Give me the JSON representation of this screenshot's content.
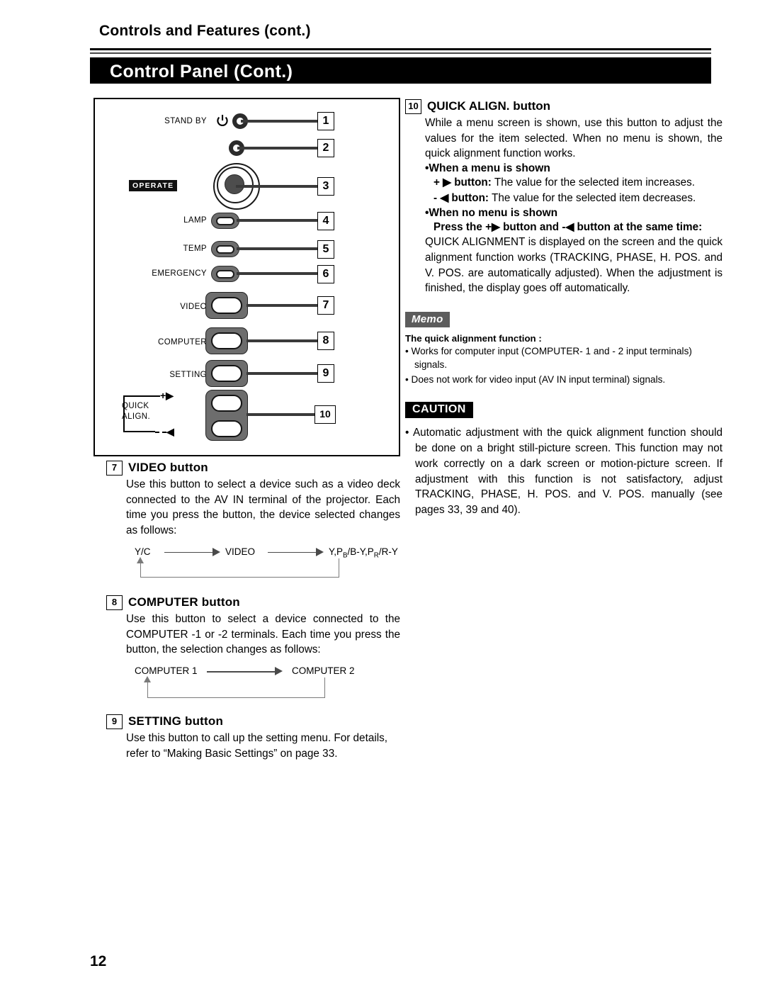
{
  "header": {
    "running_head": "Controls and Features (cont.)",
    "title": "Control Panel (Cont.)"
  },
  "diagram": {
    "name": "control-panel-illustration",
    "labels": [
      {
        "text": "STAND BY",
        "callout": "1"
      },
      {
        "text": "",
        "callout": "2"
      },
      {
        "text": "OPERATE",
        "callout": "3"
      },
      {
        "text": "LAMP",
        "callout": "4"
      },
      {
        "text": "TEMP",
        "callout": "5"
      },
      {
        "text": "EMERGENCY",
        "callout": "6"
      },
      {
        "text": "VIDEO",
        "callout": "7"
      },
      {
        "text": "COMPUTER",
        "callout": "8"
      },
      {
        "text": "SETTING",
        "callout": "9"
      },
      {
        "text": "QUICK ALIGN.",
        "callout": "10"
      }
    ],
    "stand_by_label": "STAND BY",
    "operate_label": "OPERATE",
    "lamp_label": "LAMP",
    "temp_label": "TEMP",
    "emergency_label": "EMERGENCY",
    "video_label": "VIDEO",
    "computer_label": "COMPUTER",
    "setting_label": "SETTING",
    "quick_label_1": "QUICK",
    "quick_label_2": "ALIGN.",
    "plus_sym": "+▶",
    "minus_sym": "-◀",
    "callouts": [
      "1",
      "2",
      "3",
      "4",
      "5",
      "6",
      "7",
      "8",
      "9",
      "10"
    ]
  },
  "left_column": {
    "video": {
      "num": "7",
      "title": "VIDEO button",
      "text": "Use this button to select a device such as a video deck connected to the AV IN terminal of the projector. Each time you press the button, the device selected changes as follows:",
      "flow": {
        "a": "Y/C",
        "b": "VIDEO",
        "c_pre": "Y,P",
        "c_sub1": "B",
        "c_mid": "/B-Y,P",
        "c_sub2": "R",
        "c_end": "/R-Y"
      }
    },
    "computer": {
      "num": "8",
      "title": "COMPUTER button",
      "text": "Use this button to select a device connected to the COMPUTER -1 or -2 terminals. Each time you press the button, the selection changes as follows:",
      "flow": {
        "a": "COMPUTER 1",
        "b": "COMPUTER 2"
      }
    },
    "setting": {
      "num": "9",
      "title": "SETTING button",
      "text": "Use this button to call up the setting menu. For details, refer to “Making Basic Settings” on page 33."
    }
  },
  "right_column": {
    "quick_align": {
      "num": "10",
      "title": "QUICK ALIGN. button",
      "text": "While a menu screen is shown, use this button to adjust the values for the item selected. When no menu is shown, the quick alignment function works.",
      "bullet1": "•When a menu is shown",
      "plus_line_sym": "+ ▶",
      "plus_line_label": "button:",
      "plus_line_text": "The value for the selected item increases.",
      "minus_line_sym": "- ◀",
      "minus_line_label": "button:",
      "minus_line_text": "The value for the selected item decreases.",
      "bullet2": "•When no menu is shown",
      "press_pre": "Press the",
      "press_sym1": "+▶",
      "press_mid": "button and -",
      "press_sym2": "◀",
      "press_end": "button at the same time:",
      "press_body": "QUICK ALIGNMENT is displayed on the screen and the quick alignment function works (TRACKING, PHASE, H. POS. and V. POS. are automatically adjusted). When the adjustment is finished, the display goes off automatically."
    },
    "memo": {
      "tag": "Memo",
      "subtitle": "The quick alignment  function :",
      "items": [
        "• Works for computer input (COMPUTER- 1 and - 2 input terminals) signals.",
        "• Does not work for video input (AV IN input terminal) signals."
      ]
    },
    "caution": {
      "tag": "CAUTION",
      "items": [
        "• Automatic adjustment with the quick alignment function should be done on a bright still-picture screen. This function may not work correctly on a dark screen or motion-picture screen. If adjustment with this function is not satisfactory, adjust TRACKING, PHASE, H. POS. and V. POS. manually (see pages 33, 39 and 40)."
      ]
    }
  },
  "footer": {
    "page_number": "12"
  },
  "colors": {
    "ink": "#000000",
    "bar": "#000000",
    "memo_tag": "#5c5c5c"
  }
}
